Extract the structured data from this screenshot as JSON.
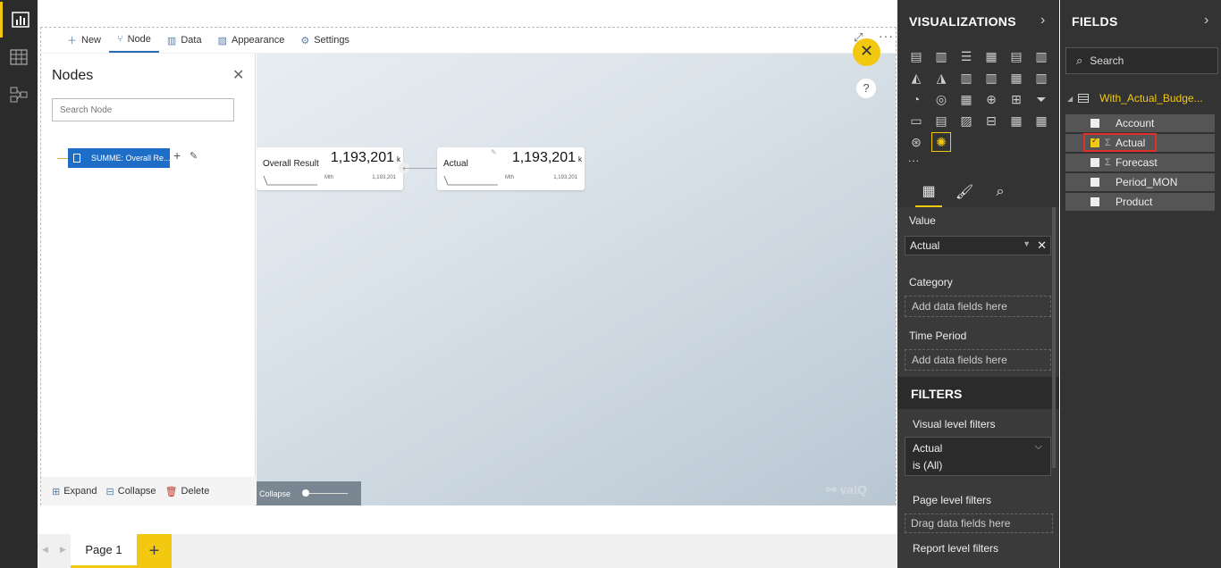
{
  "rail": {
    "items": [
      {
        "name": "report-view-icon",
        "active": true
      },
      {
        "name": "data-view-icon",
        "active": false
      },
      {
        "name": "relationships-view-icon",
        "active": false
      }
    ]
  },
  "visual_toolbar": {
    "new_label": "New",
    "node_label": "Node",
    "data_label": "Data",
    "appearance_label": "Appearance",
    "settings_label": "Settings"
  },
  "nodes_panel": {
    "title": "Nodes",
    "search_placeholder": "Search Node",
    "node_label": "SUMME: Overall Re...",
    "expand_label": "Expand",
    "collapse_label": "Collapse",
    "delete_label": "Delete"
  },
  "tree": {
    "cards": [
      {
        "label": "Overall Result",
        "value": "1,193,201",
        "unit": "k",
        "period": "Mth",
        "small_value": "1,193,201"
      },
      {
        "label": "Actual",
        "value": "1,193,201",
        "unit": "k",
        "period": "Mth",
        "small_value": "1,193,201"
      }
    ],
    "collapse_label": "Collapse",
    "logo_text": "valQ",
    "help_label": "?"
  },
  "pages": {
    "tabs": [
      "Page 1"
    ],
    "add_label": "+"
  },
  "visualizations": {
    "title": "VISUALIZATIONS",
    "icons": [
      "stacked-bar-icon",
      "stacked-column-icon",
      "clustered-bar-icon",
      "clustered-column-icon",
      "100-stacked-bar-icon",
      "100-stacked-column-icon",
      "line-chart-icon",
      "area-chart-icon",
      "stacked-area-icon",
      "line-column-icon",
      "line-clustered-column-icon",
      "ribbon-chart-icon",
      "waterfall-icon",
      "scatter-icon",
      "pie-chart-icon",
      "donut-chart-icon",
      "treemap-icon",
      "map-icon",
      "filled-map-icon",
      "funnel-icon",
      "gauge-icon",
      "card-icon",
      "multi-row-card-icon",
      "kpi-icon",
      "slicer-icon",
      "table-icon",
      "matrix-icon",
      "r-visual-icon",
      "globe-map-icon",
      "valq-icon"
    ],
    "more_label": "...",
    "tabs": [
      "fields-tab-icon",
      "format-tab-icon",
      "analytics-tab-icon"
    ],
    "wells": {
      "value_label": "Value",
      "value_field": "Actual",
      "category_label": "Category",
      "category_placeholder": "Add data fields here",
      "time_label": "Time Period",
      "time_placeholder": "Add data fields here"
    },
    "filters": {
      "title": "FILTERS",
      "visual_label": "Visual level filters",
      "visual_field": "Actual",
      "visual_condition": "is (All)",
      "page_label": "Page level filters",
      "page_placeholder": "Drag data fields here",
      "report_label": "Report level filters"
    }
  },
  "fields": {
    "title": "FIELDS",
    "search_placeholder": "Search",
    "table_name": "With_Actual_Budge...",
    "items": [
      {
        "name": "Account",
        "checked": false,
        "sigma": false
      },
      {
        "name": "Actual",
        "checked": true,
        "sigma": true
      },
      {
        "name": "Forecast",
        "checked": false,
        "sigma": true
      },
      {
        "name": "Period_MON",
        "checked": false,
        "sigma": false
      },
      {
        "name": "Product",
        "checked": false,
        "sigma": false
      }
    ]
  },
  "colors": {
    "accent": "#f2c811",
    "node_blue": "#1e6ec8",
    "pane_bg": "#333333",
    "highlight": "#e0302b"
  }
}
